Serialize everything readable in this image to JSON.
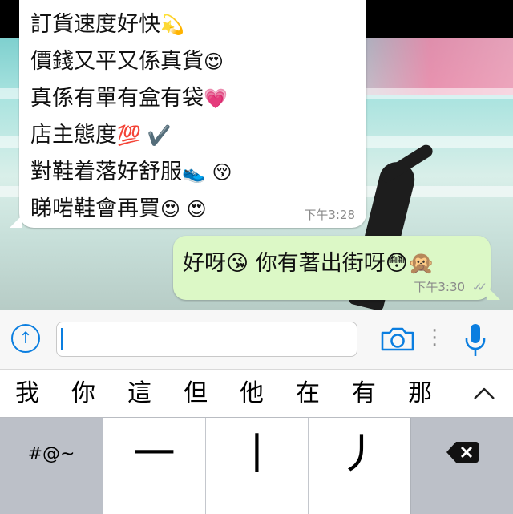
{
  "colors": {
    "accent": "#0a7ee0",
    "incoming_bubble": "#ffffff",
    "outgoing_bubble": "#dcf8c6"
  },
  "incoming": {
    "lines": [
      {
        "text": "訂貨速度好快",
        "emoji": "💫"
      },
      {
        "text": "價錢又平又係真貨",
        "emoji": "😍"
      },
      {
        "text": "真係有單有盒有袋",
        "emoji": "💗"
      },
      {
        "text": "店主態度",
        "emoji": "💯 ✔️"
      },
      {
        "text": "對鞋着落好舒服",
        "emoji": "👟 😚"
      },
      {
        "text": "睇啱鞋會再買",
        "emoji": "😍 😍"
      }
    ],
    "time": "下午3:28"
  },
  "outgoing": {
    "text": "好呀😘 你有著出街呀😳🙊",
    "time": "下午3:30",
    "ticks_icon": "double-check-icon"
  },
  "input_bar": {
    "attach_icon": "upload-arrow-icon",
    "camera_icon": "camera-icon",
    "more_icon": "vertical-dots-icon",
    "mic_icon": "microphone-icon",
    "message_value": ""
  },
  "candidates": [
    "我",
    "你",
    "這",
    "但",
    "他",
    "在",
    "有",
    "那"
  ],
  "keyboard": {
    "symbols_label": "#@~",
    "strokes": [
      "一",
      "丨",
      "丿"
    ],
    "delete_icon": "backspace-icon"
  }
}
